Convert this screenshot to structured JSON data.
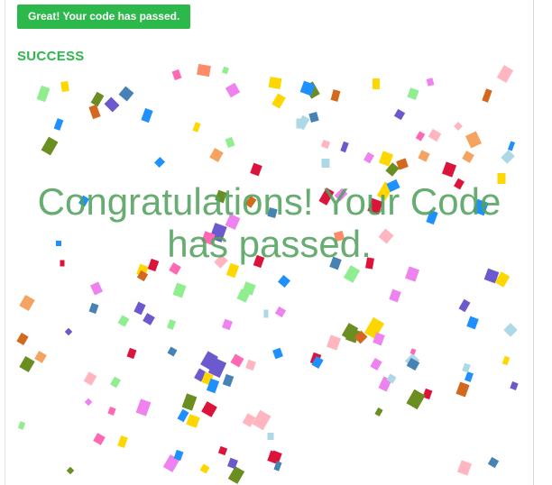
{
  "banner": {
    "text": "Great! Your code has passed."
  },
  "status": {
    "label": "SUCCESS"
  },
  "message": {
    "text": "Congratulations! Your Code has passed."
  },
  "colors": {
    "accent_green": "#2db84c",
    "message_green": "#52a05c",
    "confetti_palette": [
      "#ee82ee",
      "#ffd700",
      "#1e90ff",
      "#6a5acd",
      "#ff69b4",
      "#90ee90",
      "#f4a460",
      "#dc143c",
      "#6b8e23",
      "#add8e6",
      "#4682b4",
      "#d2691e",
      "#ffb6c1",
      "#ff8c69"
    ]
  }
}
